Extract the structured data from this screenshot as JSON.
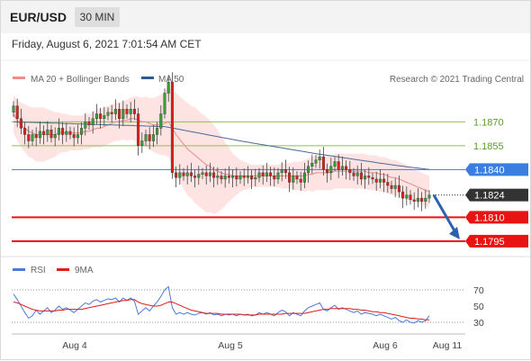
{
  "header": {
    "symbol": "EUR/USD",
    "timeframe": "30 MIN"
  },
  "datetime": "Friday, August 6, 2021 7:01:54 AM CET",
  "credit": "Research © 2021 Trading Central",
  "colors": {
    "candle_up": "#36a236",
    "candle_down": "#e0201c",
    "ma20": "#e88a8a",
    "ma50": "#4a6a9a",
    "bands": "#fddada",
    "resistance": "#8cc24a",
    "pivot": "#3a7ee0",
    "support": "#e81414",
    "last": "#333333",
    "arrow": "#2c62ad",
    "rsi": "#4a7ad8",
    "rsi_ma": "#e21b1b"
  },
  "chart_data": [
    {
      "type": "line",
      "title": "EUR/USD",
      "xlabel": "",
      "ylabel": "",
      "x_ticks": [
        "Aug 4",
        "Aug 5",
        "Aug 6",
        "Aug 11"
      ],
      "ylim": [
        1.1785,
        1.1905
      ],
      "legend": [
        {
          "name": "MA 20 + Bollinger Bands",
          "color": "#e88a8a"
        },
        {
          "name": "MA 50",
          "color": "#2f5a91"
        }
      ],
      "levels": [
        {
          "label": "1.1870",
          "value": 1.187,
          "kind": "resistance"
        },
        {
          "label": "1.1855",
          "value": 1.1855,
          "kind": "resistance"
        },
        {
          "label": "1.1840",
          "value": 1.184,
          "kind": "pivot"
        },
        {
          "label": "1.1824",
          "value": 1.1824,
          "kind": "last"
        },
        {
          "label": "1.1810",
          "value": 1.181,
          "kind": "support"
        },
        {
          "label": "1.1795",
          "value": 1.1795,
          "kind": "support"
        }
      ],
      "close": [
        1.188,
        1.1872,
        1.1866,
        1.1862,
        1.1858,
        1.1862,
        1.186,
        1.1864,
        1.1862,
        1.1865,
        1.186,
        1.1862,
        1.1866,
        1.1862,
        1.1864,
        1.1862,
        1.186,
        1.1862,
        1.1866,
        1.187,
        1.1868,
        1.1872,
        1.1875,
        1.1872,
        1.1874,
        1.1876,
        1.1875,
        1.1878,
        1.1872,
        1.1878,
        1.1875,
        1.1878,
        1.1875,
        1.1855,
        1.1858,
        1.1862,
        1.1858,
        1.1862,
        1.1866,
        1.1875,
        1.1888,
        1.1895,
        1.1838,
        1.1835,
        1.1838,
        1.1836,
        1.1838,
        1.1836,
        1.1835,
        1.1837,
        1.1838,
        1.1836,
        1.1838,
        1.1835,
        1.1836,
        1.1834,
        1.1836,
        1.1835,
        1.1836,
        1.1834,
        1.1836,
        1.1835,
        1.1836,
        1.1834,
        1.1835,
        1.1838,
        1.1836,
        1.1838,
        1.1836,
        1.1834,
        1.1838,
        1.184,
        1.1838,
        1.1832,
        1.1836,
        1.1834,
        1.1832,
        1.1838,
        1.1842,
        1.1844,
        1.1846,
        1.1848,
        1.184,
        1.1838,
        1.1842,
        1.1845,
        1.184,
        1.1842,
        1.184,
        1.1838,
        1.1836,
        1.1838,
        1.1834,
        1.1836,
        1.1835,
        1.1834,
        1.1832,
        1.1834,
        1.1832,
        1.183,
        1.1828,
        1.183,
        1.1826,
        1.1822,
        1.1824,
        1.1821,
        1.182,
        1.1822,
        1.182,
        1.1822,
        1.1824
      ],
      "ma20": [
        1.1875,
        1.1871,
        1.1868,
        1.1866,
        1.1864,
        1.1863,
        1.1862,
        1.1862,
        1.1862,
        1.1862,
        1.1862,
        1.1862,
        1.1863,
        1.1863,
        1.1863,
        1.1863,
        1.1863,
        1.1863,
        1.1863,
        1.1864,
        1.1864,
        1.1865,
        1.1866,
        1.1866,
        1.1867,
        1.1868,
        1.1869,
        1.187,
        1.187,
        1.1871,
        1.1871,
        1.1872,
        1.1872,
        1.1871,
        1.187,
        1.187,
        1.1869,
        1.1868,
        1.1868,
        1.1868,
        1.1869,
        1.187,
        1.1866,
        1.1862,
        1.1859,
        1.1856,
        1.1853,
        1.1851,
        1.1849,
        1.1847,
        1.1845,
        1.1843,
        1.1842,
        1.184,
        1.1839,
        1.1838,
        1.1837,
        1.1837,
        1.1836,
        1.1836,
        1.1836,
        1.1836,
        1.1836,
        1.1836,
        1.1836,
        1.1836,
        1.1836,
        1.1836,
        1.1836,
        1.1836,
        1.1836,
        1.1836,
        1.1836,
        1.1836,
        1.1836,
        1.1836,
        1.1836,
        1.1836,
        1.1837,
        1.1837,
        1.1838,
        1.1838,
        1.1838,
        1.1838,
        1.1838,
        1.1839,
        1.1839,
        1.1839,
        1.1839,
        1.1839,
        1.1839,
        1.1839,
        1.1839,
        1.1839,
        1.1838,
        1.1838,
        1.1838,
        1.1837,
        1.1837,
        1.1836,
        1.1835,
        1.1835,
        1.1834,
        1.1833,
        1.1832,
        1.1831,
        1.183,
        1.1829,
        1.1828,
        1.1827,
        1.1826
      ],
      "band_width": [
        0.0012,
        0.0013,
        0.0014,
        0.0015,
        0.0016,
        0.0016,
        0.0017,
        0.0017,
        0.0017,
        0.0016,
        0.0015,
        0.0014,
        0.0013,
        0.0012,
        0.0012,
        0.0011,
        0.0011,
        0.0011,
        0.0011,
        0.0011,
        0.0011,
        0.0011,
        0.0012,
        0.0012,
        0.0012,
        0.0012,
        0.0012,
        0.0012,
        0.0012,
        0.0012,
        0.0013,
        0.0013,
        0.0014,
        0.0015,
        0.0015,
        0.0016,
        0.0016,
        0.0017,
        0.0018,
        0.0019,
        0.002,
        0.0022,
        0.0024,
        0.0026,
        0.0027,
        0.0028,
        0.0029,
        0.0029,
        0.003,
        0.003,
        0.003,
        0.003,
        0.0029,
        0.0028,
        0.0026,
        0.0023,
        0.002,
        0.0017,
        0.0014,
        0.0012,
        0.001,
        0.0009,
        0.0008,
        0.0007,
        0.0007,
        0.0007,
        0.0007,
        0.0007,
        0.0007,
        0.0007,
        0.0007,
        0.0008,
        0.0008,
        0.0008,
        0.0009,
        0.0009,
        0.0009,
        0.001,
        0.001,
        0.0011,
        0.0011,
        0.0011,
        0.0011,
        0.0011,
        0.0011,
        0.0011,
        0.0011,
        0.0011,
        0.0011,
        0.0011,
        0.0011,
        0.0011,
        0.0011,
        0.0011,
        0.0011,
        0.0011,
        0.0011,
        0.0011,
        0.0011,
        0.0011,
        0.0011,
        0.0011,
        0.0011,
        0.0011,
        0.0011,
        0.001,
        0.001,
        0.001,
        0.001,
        0.001,
        0.001
      ],
      "ma50_nodes": [
        [
          0,
          1.187
        ],
        [
          40,
          1.1867
        ],
        [
          60,
          1.1858
        ],
        [
          80,
          1.185
        ],
        [
          100,
          1.1843
        ],
        [
          110,
          1.184
        ]
      ],
      "forecast": {
        "from": 1.1824,
        "to": 1.1795
      }
    },
    {
      "type": "line",
      "title": "",
      "ylim": [
        20,
        80
      ],
      "y_ticks": [
        70,
        50,
        30
      ],
      "reference_lines": [
        70,
        30
      ],
      "legend": [
        {
          "name": "RSI",
          "color": "#4a7ad8"
        },
        {
          "name": "9MA",
          "color": "#e21b1b"
        }
      ],
      "rsi": [
        65,
        58,
        50,
        42,
        35,
        38,
        45,
        40,
        44,
        48,
        42,
        45,
        50,
        46,
        48,
        45,
        42,
        46,
        50,
        54,
        52,
        56,
        58,
        55,
        57,
        59,
        58,
        60,
        55,
        60,
        57,
        60,
        56,
        40,
        44,
        48,
        44,
        50,
        55,
        62,
        70,
        74,
        48,
        40,
        42,
        40,
        42,
        40,
        39,
        41,
        42,
        40,
        42,
        39,
        40,
        38,
        40,
        39,
        40,
        38,
        40,
        39,
        40,
        38,
        39,
        42,
        40,
        42,
        40,
        38,
        42,
        45,
        43,
        38,
        42,
        40,
        38,
        44,
        48,
        50,
        52,
        54,
        46,
        44,
        48,
        51,
        46,
        48,
        46,
        44,
        42,
        44,
        40,
        42,
        41,
        40,
        38,
        40,
        38,
        36,
        34,
        36,
        32,
        30,
        33,
        30,
        29,
        32,
        30,
        32,
        38
      ],
      "rsi_ma": [
        55,
        54,
        52,
        50,
        48,
        46,
        45,
        44,
        44,
        44,
        44,
        44,
        45,
        45,
        46,
        46,
        46,
        46,
        46,
        47,
        48,
        49,
        50,
        51,
        52,
        53,
        54,
        55,
        56,
        57,
        57,
        58,
        58,
        55,
        53,
        52,
        51,
        50,
        50,
        51,
        53,
        55,
        55,
        53,
        51,
        49,
        47,
        45,
        44,
        43,
        42,
        41,
        41,
        41,
        41,
        40,
        40,
        40,
        40,
        40,
        40,
        39,
        39,
        39,
        39,
        40,
        40,
        40,
        40,
        40,
        40,
        40,
        41,
        41,
        41,
        41,
        41,
        41,
        42,
        43,
        44,
        45,
        46,
        46,
        47,
        47,
        47,
        47,
        47,
        47,
        46,
        46,
        45,
        45,
        44,
        43,
        43,
        42,
        42,
        41,
        40,
        39,
        38,
        37,
        36,
        35,
        35,
        34,
        34,
        33,
        33
      ]
    }
  ]
}
